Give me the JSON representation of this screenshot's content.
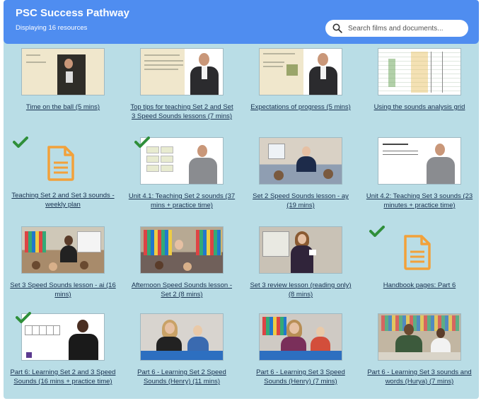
{
  "header": {
    "title": "PSC Success Pathway",
    "count": "Displaying 16 resources",
    "search_placeholder": "Search films and documents..."
  },
  "colors": {
    "header": "#4f8df0",
    "background": "#b9dde6",
    "check": "#2f8f3a",
    "doc_icon": "#f2a13a",
    "link": "#17304f"
  },
  "resources": [
    {
      "label": "Time on the ball (5 mins)",
      "thumb": "slide-woman",
      "completed": false
    },
    {
      "label": "Top tips for teaching Set 2 and Set 3 Speed Sounds lessons (7 mins)",
      "thumb": "slide-man",
      "completed": false
    },
    {
      "label": "Expectations of progress (5 mins)",
      "thumb": "slide-man-image",
      "completed": false
    },
    {
      "label": "Using the sounds analysis grid",
      "thumb": "spreadsheet",
      "completed": false
    },
    {
      "label": "Teaching Set 2 and Set 3 sounds - weekly plan",
      "thumb": "document-icon",
      "completed": true
    },
    {
      "label": "Unit 4.1: Teaching Set 2 sounds (37 mins + practice time)",
      "thumb": "slide-sounds",
      "completed": true
    },
    {
      "label": "Set 2 Speed Sounds lesson - ay (19 mins)",
      "thumb": "classroom-teacher",
      "completed": false
    },
    {
      "label": "Unit 4.2: Teaching Set 3 sounds (23 minutes + practice time)",
      "thumb": "slide-white-man",
      "completed": false
    },
    {
      "label": "Set 3 Speed Sounds lesson - ai (16 mins)",
      "thumb": "classroom-carpet",
      "completed": false
    },
    {
      "label": "Afternoon Speed Sounds lesson - Set 2 (8 mins)",
      "thumb": "classroom-shelves",
      "completed": false
    },
    {
      "label": "Set 3 review lesson (reading only) (8 mins)",
      "thumb": "classroom-woman",
      "completed": false
    },
    {
      "label": "Handbook pages: Part 6",
      "thumb": "document-icon",
      "completed": true
    },
    {
      "label": "Part 6: Learning Set 2 and 3 Speed Sounds (16 mins + practice time)",
      "thumb": "slide-woman-white",
      "completed": true
    },
    {
      "label": "Part 6 - Learning Set 2 Speed Sounds (Henry) (11 mins)",
      "thumb": "table-pair",
      "completed": false
    },
    {
      "label": "Part 6 - Learning Set 3 Speed Sounds (Henry) (7 mins)",
      "thumb": "table-pair-2",
      "completed": false
    },
    {
      "label": "Part 6 - Learning Set 3 sounds and words (Hurya) (7 mins)",
      "thumb": "table-pair-3",
      "completed": false
    }
  ]
}
